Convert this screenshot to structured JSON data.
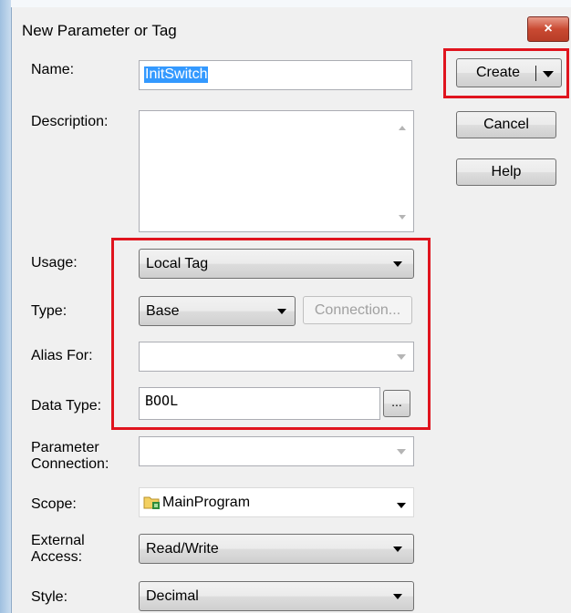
{
  "window": {
    "title": "New Parameter or Tag",
    "close_glyph": "×"
  },
  "fields": {
    "name_label": "Name:",
    "name_value": "InitSwitch",
    "description_label": "Description:",
    "usage_label": "Usage:",
    "usage_value": "Local Tag",
    "type_label": "Type:",
    "type_value": "Base",
    "connection_button": "Connection...",
    "alias_label": "Alias For:",
    "alias_value": "",
    "data_type_label": "Data Type:",
    "data_type_value": "BOOL",
    "browse_button": "...",
    "parameter_connection_label": "Parameter Connection:",
    "parameter_connection_line1": "Parameter",
    "parameter_connection_line2": "Connection:",
    "scope_label": "Scope:",
    "scope_value": "MainProgram",
    "scope_icon": "program-folder-icon",
    "external_access_line1": "External",
    "external_access_line2": "Access:",
    "external_access_value": "Read/Write",
    "style_label": "Style:",
    "style_value": "Decimal"
  },
  "buttons": {
    "create": "Create",
    "cancel": "Cancel",
    "help": "Help"
  },
  "colors": {
    "highlight_box": "#e0141e",
    "selection": "#3399ff",
    "close_button": "#c94a32"
  }
}
